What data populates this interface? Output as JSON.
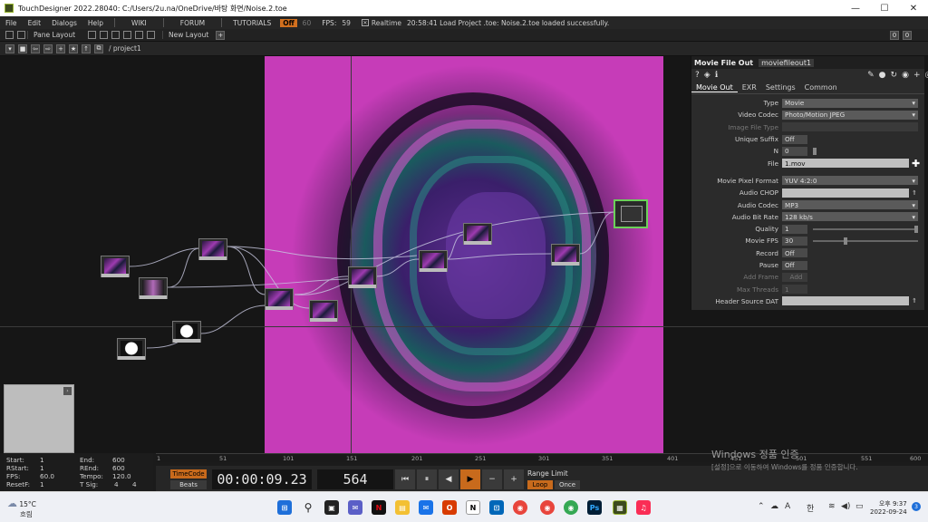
{
  "window": {
    "title": "TouchDesigner 2022.28040: C:/Users/2u.na/OneDrive/바탕 화면/Noise.2.toe",
    "minimize": "—",
    "maximize": "☐",
    "close": "✕"
  },
  "menu": {
    "items": [
      "File",
      "Edit",
      "Dialogs",
      "Help"
    ],
    "wiki": "WIKI",
    "forum": "FORUM",
    "tutorials": "TUTORIALS",
    "fps_badge": "Off",
    "fps_target": "60",
    "fps_label": "FPS:",
    "fps_value": "59",
    "realtime": "Realtime",
    "status": "20:58:41 Load Project .toe: Noise.2.toe loaded successfully."
  },
  "panebar": {
    "pane_layout": "Pane Layout",
    "new_layout": "New Layout",
    "add": "+",
    "right_0": "0",
    "right_1": "0"
  },
  "pathbar": {
    "path": "/ project1"
  },
  "params": {
    "op_type": "Movie File Out",
    "op_name": "moviefileout1",
    "tabs": [
      "Movie Out",
      "EXR",
      "Settings",
      "Common"
    ],
    "rows": {
      "type": {
        "label": "Type",
        "value": "Movie"
      },
      "vcodec": {
        "label": "Video Codec",
        "value": "Photo/Motion JPEG"
      },
      "imgtype": {
        "label": "Image File Type",
        "value": ""
      },
      "unique": {
        "label": "Unique Suffix",
        "value": "Off"
      },
      "n": {
        "label": "N",
        "value": "0"
      },
      "file": {
        "label": "File",
        "value": "1.mov"
      },
      "pixfmt": {
        "label": "Movie Pixel Format",
        "value": "YUV 4:2:0"
      },
      "achop": {
        "label": "Audio CHOP",
        "value": ""
      },
      "acodec": {
        "label": "Audio Codec",
        "value": "MP3"
      },
      "abitrate": {
        "label": "Audio Bit Rate",
        "value": "128 kb/s"
      },
      "quality": {
        "label": "Quality",
        "value": "1"
      },
      "mfps": {
        "label": "Movie FPS",
        "value": "30"
      },
      "record": {
        "label": "Record",
        "value": "Off"
      },
      "pause": {
        "label": "Pause",
        "value": "Off"
      },
      "addframe": {
        "label": "Add Frame",
        "value": "Add"
      },
      "maxthreads": {
        "label": "Max Threads",
        "value": "1"
      },
      "header": {
        "label": "Header Source DAT",
        "value": ""
      }
    }
  },
  "info": {
    "start_l": "Start:",
    "start": "1",
    "rstart_l": "RStart:",
    "rstart": "1",
    "fps_l": "FPS:",
    "fps": "60.0",
    "resetf_l": "ResetF:",
    "resetf": "1",
    "end_l": "End:",
    "end": "600",
    "rend_l": "REnd:",
    "rend": "600",
    "tempo_l": "Tempo:",
    "tempo": "120.0",
    "tsig_l": "T Sig:",
    "tsig_a": "4",
    "tsig_b": "4"
  },
  "ruler_ticks": [
    "1",
    "51",
    "101",
    "151",
    "201",
    "251",
    "301",
    "351",
    "401",
    "451",
    "501",
    "551",
    "600"
  ],
  "transport": {
    "timecode_btn": "TimeCode",
    "beats_btn": "Beats",
    "timecode": "00:00:09.23",
    "frame": "564",
    "range_label": "Range Limit",
    "loop": "Loop",
    "once": "Once"
  },
  "watermark": {
    "line1": "Windows 정품 인증",
    "line2": "[설정]으로 이동하여 Windows를 정품 인증합니다."
  },
  "taskbar": {
    "temp": "15°C",
    "weather": "흐림",
    "time": "오후 9:37",
    "date": "2022-09-24",
    "lang": "A",
    "ime": "한",
    "badge": "3"
  }
}
